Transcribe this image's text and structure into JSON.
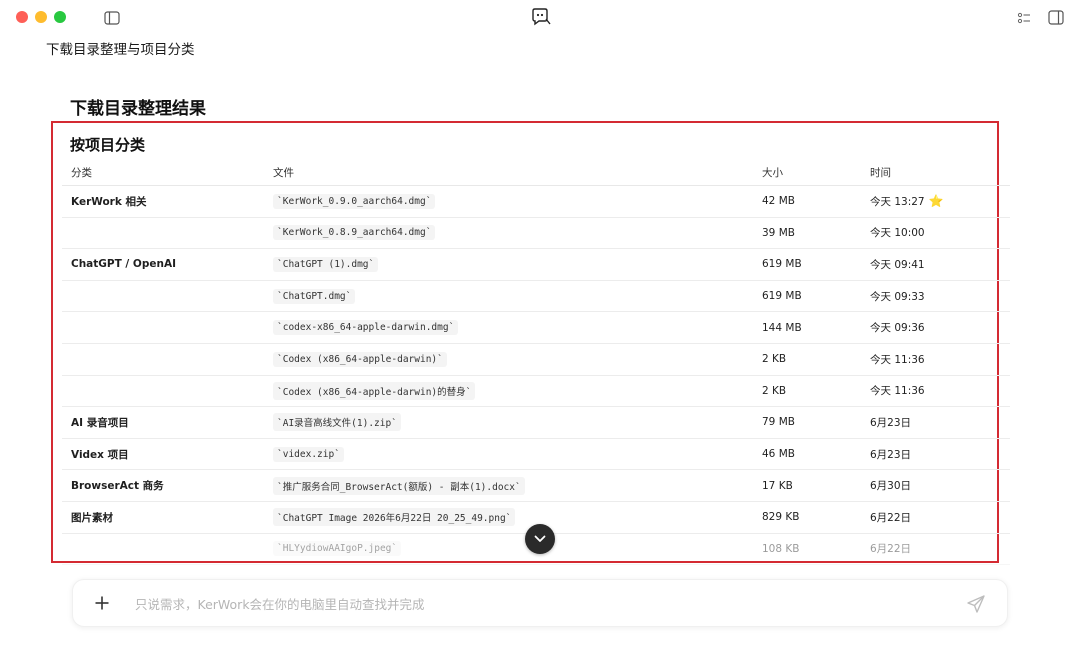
{
  "window": {
    "chat_title": "下载目录整理与项目分类",
    "icons": [
      "sidebar-toggle-icon",
      "app-logo-icon",
      "tasks-icon",
      "panel-icon"
    ]
  },
  "content": {
    "heading": "下载目录整理结果",
    "subheading": "按项目分类",
    "highlight_color": "#d42a32"
  },
  "table": {
    "headers": {
      "category": "分类",
      "file": "文件",
      "size": "大小",
      "time": "时间"
    },
    "rows": [
      {
        "category": "KerWork 相关",
        "file": "`KerWork_0.9.0_aarch64.dmg`",
        "size": "42 MB",
        "time": "今天 13:27",
        "star": "⭐"
      },
      {
        "category": "",
        "file": "`KerWork_0.8.9_aarch64.dmg`",
        "size": "39 MB",
        "time": "今天 10:00"
      },
      {
        "category": "ChatGPT / OpenAI",
        "file": "`ChatGPT (1).dmg`",
        "size": "619 MB",
        "time": "今天 09:41"
      },
      {
        "category": "",
        "file": "`ChatGPT.dmg`",
        "size": "619 MB",
        "time": "今天 09:33"
      },
      {
        "category": "",
        "file": "`codex-x86_64-apple-darwin.dmg`",
        "size": "144 MB",
        "time": "今天 09:36"
      },
      {
        "category": "",
        "file": "`Codex (x86_64-apple-darwin)`",
        "size": "2 KB",
        "time": "今天 11:36"
      },
      {
        "category": "",
        "file": "`Codex (x86_64-apple-darwin)的替身`",
        "size": "2 KB",
        "time": "今天 11:36"
      },
      {
        "category": "AI 录音项目",
        "file": "`AI录音高线文件(1).zip`",
        "size": "79 MB",
        "time": "6月23日"
      },
      {
        "category": "Videx 项目",
        "file": "`videx.zip`",
        "size": "46 MB",
        "time": "6月23日"
      },
      {
        "category": "BrowserAct 商务",
        "file": "`推广服务合同_BrowserAct(额版) - 副本(1).docx`",
        "size": "17 KB",
        "time": "6月30日"
      },
      {
        "category": "图片素材",
        "file": "`ChatGPT Image 2026年6月22日 20_25_49.png`",
        "size": "829 KB",
        "time": "6月22日"
      },
      {
        "category": "",
        "file": "`HLYydiowAAIgoP.jpeg`",
        "size": "108 KB",
        "time": "6月22日"
      }
    ]
  },
  "composer": {
    "placeholder": "只说需求，KerWork会在你的电脑里自动查找并完成",
    "value": ""
  }
}
